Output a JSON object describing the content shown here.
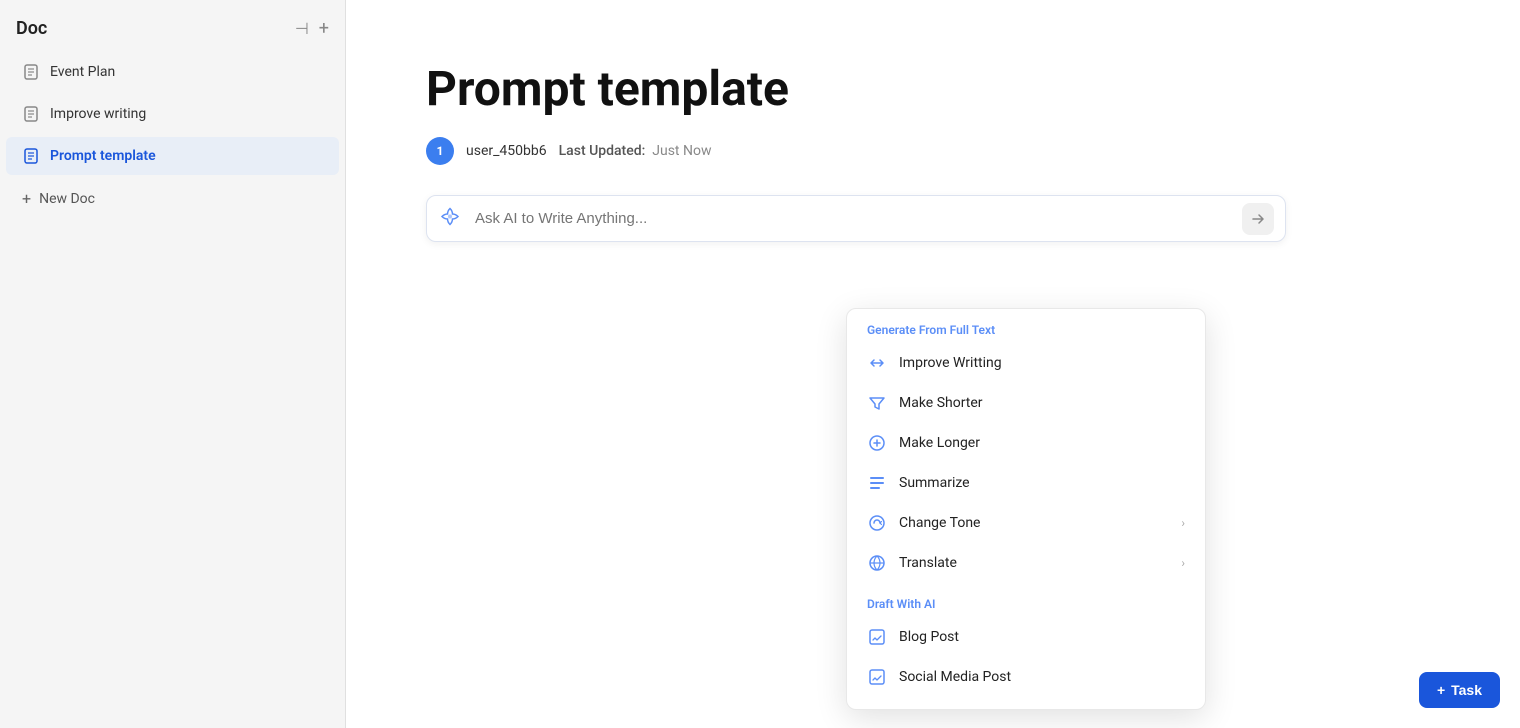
{
  "sidebar": {
    "title": "Doc",
    "controls": {
      "collapse": "⊢",
      "add": "+"
    },
    "items": [
      {
        "id": "event-plan",
        "label": "Event Plan",
        "icon": "doc",
        "active": false
      },
      {
        "id": "improve-writing",
        "label": "Improve writing",
        "icon": "doc",
        "active": false
      },
      {
        "id": "prompt-template",
        "label": "Prompt template",
        "icon": "doc-blue",
        "active": true
      }
    ],
    "new_doc_label": "+ New Doc"
  },
  "main": {
    "title": "Prompt template",
    "meta": {
      "user": "user_450bb6",
      "updated_label": "Last Updated:",
      "updated_value": "Just Now"
    },
    "ai_input": {
      "placeholder": "Ask AI to Write Anything..."
    }
  },
  "dropdown": {
    "sections": [
      {
        "id": "generate",
        "label": "Generate From Full Text",
        "items": [
          {
            "id": "improve-writing",
            "label": "Improve Writting",
            "icon": "arrows",
            "has_submenu": false
          },
          {
            "id": "make-shorter",
            "label": "Make Shorter",
            "icon": "funnel",
            "has_submenu": false
          },
          {
            "id": "make-longer",
            "label": "Make Longer",
            "icon": "circle-plus",
            "has_submenu": false
          },
          {
            "id": "summarize",
            "label": "Summarize",
            "icon": "lines",
            "has_submenu": false
          },
          {
            "id": "change-tone",
            "label": "Change Tone",
            "icon": "arrows-circle",
            "has_submenu": true
          },
          {
            "id": "translate",
            "label": "Translate",
            "icon": "globe-arrows",
            "has_submenu": true
          }
        ]
      },
      {
        "id": "draft",
        "label": "Draft With AI",
        "items": [
          {
            "id": "blog-post",
            "label": "Blog Post",
            "icon": "edit-box",
            "has_submenu": false
          },
          {
            "id": "social-media",
            "label": "Social Media Post",
            "icon": "edit-box-2",
            "has_submenu": false
          }
        ]
      }
    ]
  },
  "task_button": {
    "label": "+ Task"
  }
}
